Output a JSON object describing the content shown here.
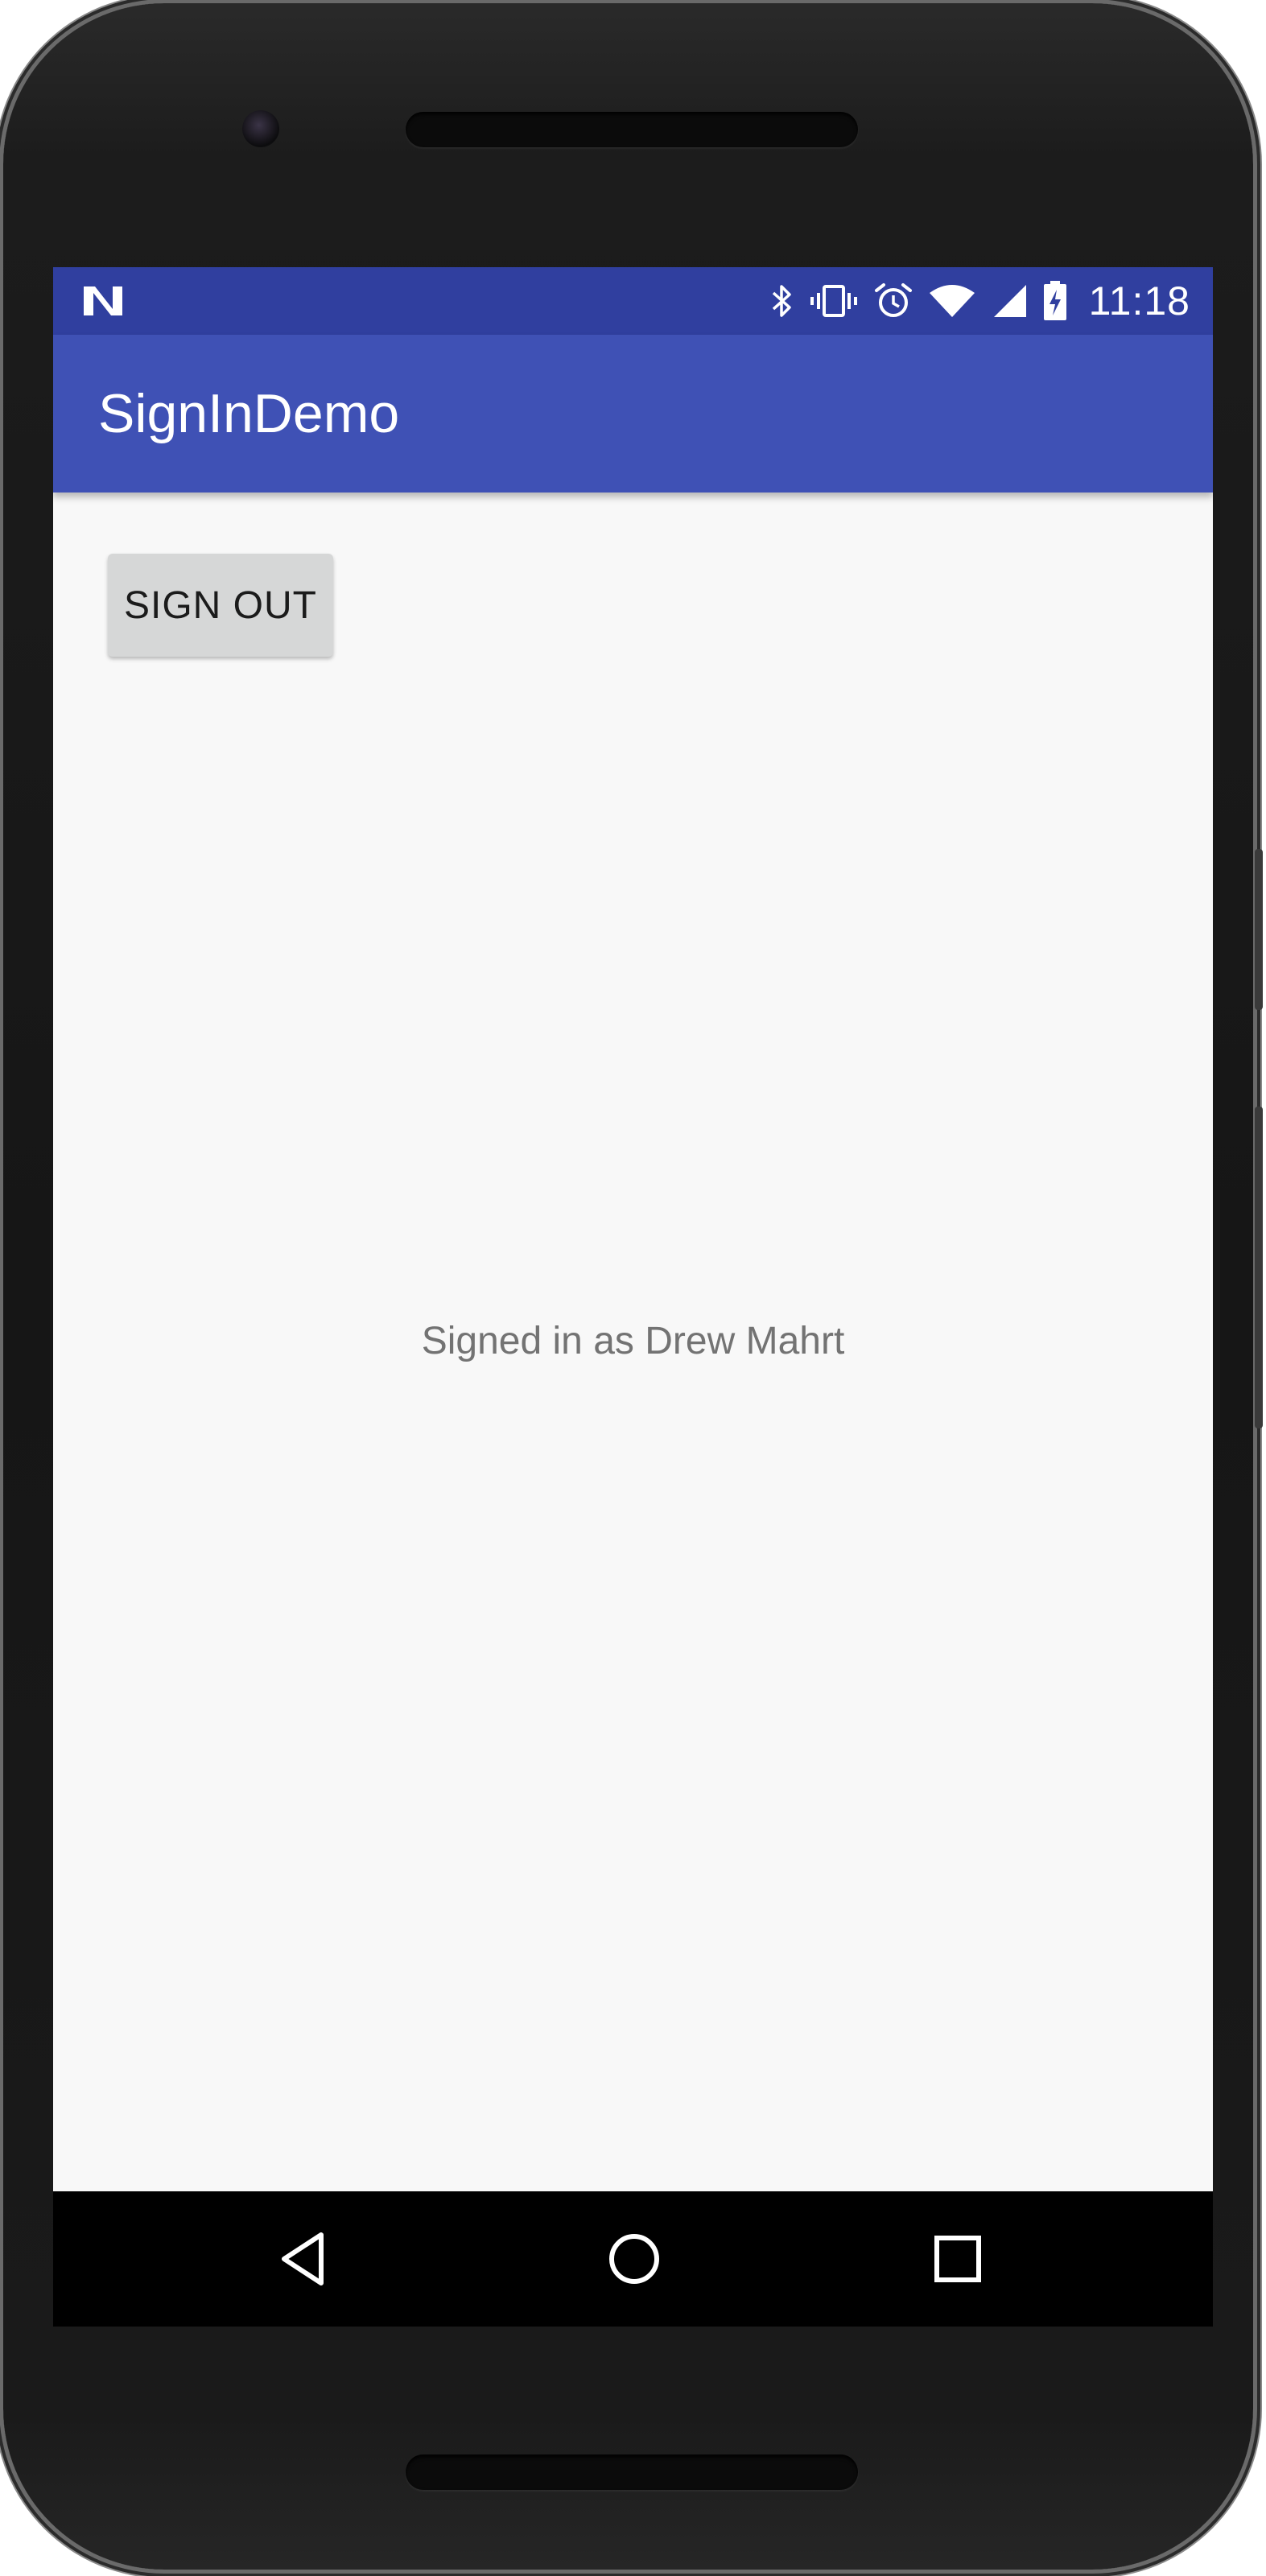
{
  "status_bar": {
    "clock": "11:18",
    "colors": {
      "background": "#303f9f"
    },
    "icons": [
      "nougat-n-icon",
      "bluetooth-icon",
      "vibrate-icon",
      "alarm-icon",
      "wifi-icon",
      "cellular-signal-icon",
      "battery-charging-icon"
    ]
  },
  "app_bar": {
    "title": "SignInDemo",
    "colors": {
      "background": "#3f51b5"
    }
  },
  "content": {
    "sign_out_label": "SIGN OUT",
    "status_message": "Signed in as Drew Mahrt"
  },
  "nav_bar": {
    "icons": [
      "back-icon",
      "home-icon",
      "recents-icon"
    ]
  }
}
